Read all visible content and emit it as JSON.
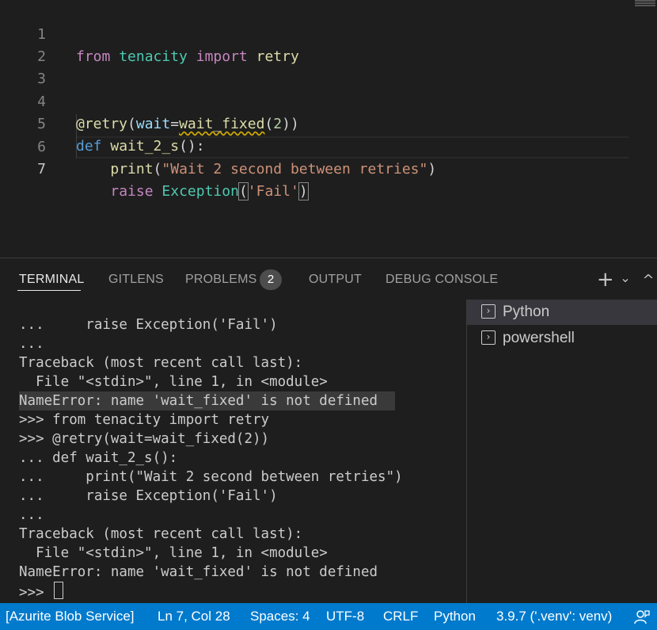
{
  "editor": {
    "line_numbers": [
      "1",
      "2",
      "3",
      "4",
      "5",
      "6",
      "7"
    ],
    "line1": {
      "kw_from": "from",
      "module": "tenacity",
      "kw_import": "import",
      "name": "retry"
    },
    "line4": {
      "decorator": "@retry",
      "open": "(",
      "param": "wait",
      "eq": "=",
      "func": "wait_fixed",
      "open2": "(",
      "num": "2",
      "close": "))"
    },
    "line5": {
      "kw_def": "def",
      "func": "wait_2_s",
      "rest": "():"
    },
    "line6": {
      "func": "print",
      "open": "(",
      "str": "\"Wait 2 second between retries\"",
      "close": ")"
    },
    "line7": {
      "kw": "raise",
      "cls": "Exception",
      "open": "(",
      "str": "'Fail'",
      "close": ")"
    }
  },
  "panel": {
    "tabs": [
      {
        "label": "TERMINAL"
      },
      {
        "label": "GITLENS"
      },
      {
        "label": "PROBLEMS"
      },
      {
        "label": "OUTPUT"
      },
      {
        "label": "DEBUG CONSOLE"
      }
    ],
    "problems_count": "2",
    "actions": {
      "add": "+",
      "dropdown": "⌄",
      "maximize": "^"
    }
  },
  "terminal": {
    "lines": [
      "...     raise Exception('Fail')",
      "...",
      "Traceback (most recent call last):",
      "  File \"<stdin>\", line 1, in <module>",
      "NameError: name 'wait_fixed' is not defined",
      ">>> from tenacity import retry",
      ">>> @retry(wait=wait_fixed(2))",
      "... def wait_2_s():",
      "...     print(\"Wait 2 second between retries\")",
      "...     raise Exception('Fail')",
      "...",
      "Traceback (most recent call last):",
      "  File \"<stdin>\", line 1, in <module>",
      "NameError: name 'wait_fixed' is not defined"
    ],
    "prompt": ">>> ",
    "list": [
      {
        "label": "Python",
        "icon": "terminal-icon"
      },
      {
        "label": "powershell",
        "icon": "terminal-icon"
      }
    ]
  },
  "statusbar": {
    "remote": "[Azurite Blob Service]",
    "position": "Ln 7, Col 28",
    "spaces": "Spaces: 4",
    "encoding": "UTF-8",
    "eol": "CRLF",
    "language": "Python",
    "interpreter": "3.9.7 ('.venv': venv)",
    "feedback_icon": "feedback-icon"
  },
  "colors": {
    "statusbar": "#007acc",
    "keyword": "#c586c0",
    "def": "#569cd6",
    "type": "#4ec9b0",
    "function": "#dcdcaa",
    "variable": "#9cdcfe",
    "string": "#ce9178",
    "number": "#b5cea8"
  }
}
